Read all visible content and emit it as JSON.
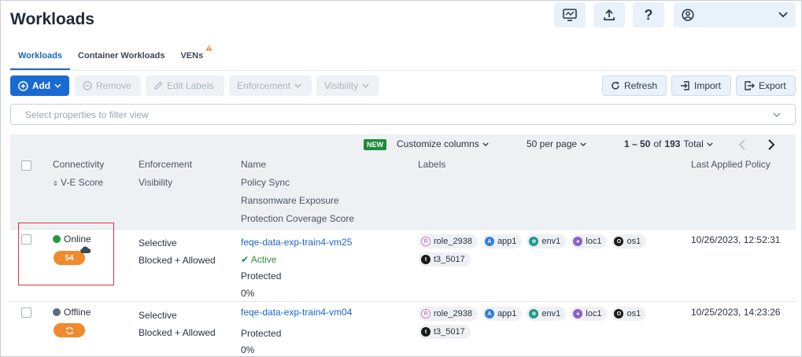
{
  "header": {
    "title": "Workloads"
  },
  "tabs": [
    {
      "label": "Workloads"
    },
    {
      "label": "Container Workloads"
    },
    {
      "label": "VENs"
    }
  ],
  "toolbar": {
    "add": "Add",
    "remove": "Remove",
    "edit_labels": "Edit Labels",
    "enforcement": "Enforcement",
    "visibility": "Visibility",
    "refresh": "Refresh",
    "import": "Import",
    "export": "Export"
  },
  "filter": {
    "placeholder": "Select properties to filter view"
  },
  "grid_bar": {
    "new_badge": "NEW",
    "customize": "Customize columns",
    "per_page": "50 per page",
    "range": "1 – 50",
    "of": "of",
    "total_count": "193",
    "total": "Total"
  },
  "columns": {
    "connectivity": "Connectivity",
    "ve_score": "V-E Score",
    "enforcement": "Enforcement",
    "visibility": "Visibility",
    "name": "Name",
    "policy_sync": "Policy Sync",
    "ransomware": "Ransomware Exposure",
    "protection": "Protection Coverage Score",
    "labels": "Labels",
    "last_policy": "Last Applied Policy"
  },
  "rows": [
    {
      "status": "Online",
      "status_color": "#1f9a3a",
      "score": "54",
      "enforcement": "Selective",
      "visibility": "Blocked + Allowed",
      "name": "feqe-data-exp-train4-vm25",
      "policy_sync": "Active",
      "ransomware": "Protected",
      "protection": "0%",
      "labels": [
        "role_2938",
        "app1",
        "env1",
        "loc1",
        "os1",
        "t3_5017"
      ],
      "last_policy": "10/26/2023, 12:52:31"
    },
    {
      "status": "Offline",
      "status_color": "#5d6b7a",
      "enforcement": "Selective",
      "visibility": "Blocked + Allowed",
      "name": "feqe-data-exp-train4-vm04",
      "ransomware": "Protected",
      "protection": "0%",
      "labels": [
        "role_2938",
        "app1",
        "env1",
        "loc1",
        "os1",
        "t3_5017"
      ],
      "last_policy": "10/25/2023, 14:23:26"
    }
  ],
  "colors": {
    "primary": "#1b6ad1",
    "score_orange": "#f08a2c",
    "highlight_red": "#d9363e",
    "role": "#c77dc9",
    "app": "#2f7de1",
    "env": "#1f9a8a",
    "loc": "#8a63c9",
    "os": "#1b1b1b",
    "t": "#1b1b1b"
  }
}
